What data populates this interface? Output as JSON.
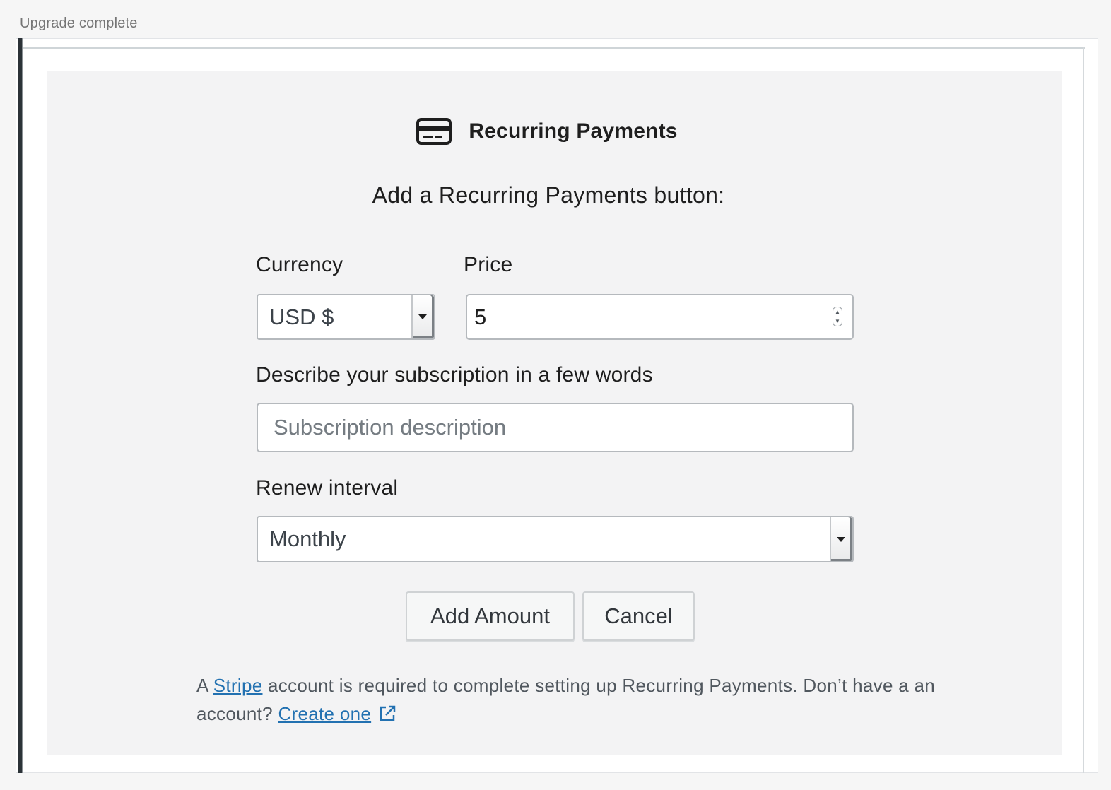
{
  "status": {
    "text": "Upgrade complete"
  },
  "block": {
    "icon": "credit-card-icon",
    "title": "Recurring Payments",
    "instructions": "Add a Recurring Payments button:"
  },
  "form": {
    "currency": {
      "label": "Currency",
      "value": "USD $"
    },
    "price": {
      "label": "Price",
      "value": "5"
    },
    "description": {
      "label": "Describe your subscription in a few words",
      "placeholder": "Subscription description",
      "value": ""
    },
    "interval": {
      "label": "Renew interval",
      "value": "Monthly"
    },
    "buttons": {
      "add_amount": "Add Amount",
      "cancel": "Cancel"
    }
  },
  "help": {
    "prefix": "A",
    "stripe_link": "Stripe",
    "middle": "account is required to complete setting up Recurring Payments. Don’t have a an account?",
    "create_link": "Create one",
    "external_icon": "external-link-icon"
  },
  "colors": {
    "link": "#2271b1",
    "placeholder_bg": "#f3f3f4",
    "text": "#1e1e1e"
  }
}
